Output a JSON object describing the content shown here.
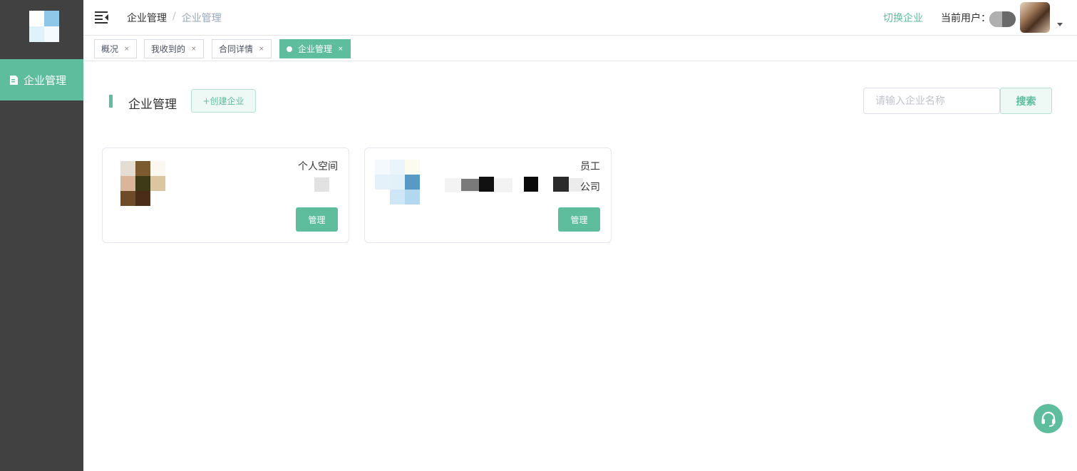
{
  "sidebar": {
    "menu_item": "企业管理",
    "menu_icon": "document-icon"
  },
  "header": {
    "breadcrumb_root": "企业管理",
    "breadcrumb_sep": "/",
    "breadcrumb_current": "企业管理",
    "switch_company": "切换企业",
    "current_user_label": "当前用户："
  },
  "tabs": [
    {
      "label": "概况",
      "close": "×"
    },
    {
      "label": "我收到的",
      "close": "×"
    },
    {
      "label": "合同详情",
      "close": "×"
    },
    {
      "label": "企业管理",
      "close": "×"
    }
  ],
  "main": {
    "title": "企业管理",
    "create_button": "+创建企业",
    "search_placeholder": "请输入企业名称",
    "search_button": "搜索"
  },
  "cards": [
    {
      "role": "个人空间",
      "manage": "管理"
    },
    {
      "role": "员工",
      "org_suffix": "公司",
      "manage": "管理"
    }
  ],
  "colors": {
    "accent": "#5dbd9c",
    "sidebar": "#414141"
  }
}
